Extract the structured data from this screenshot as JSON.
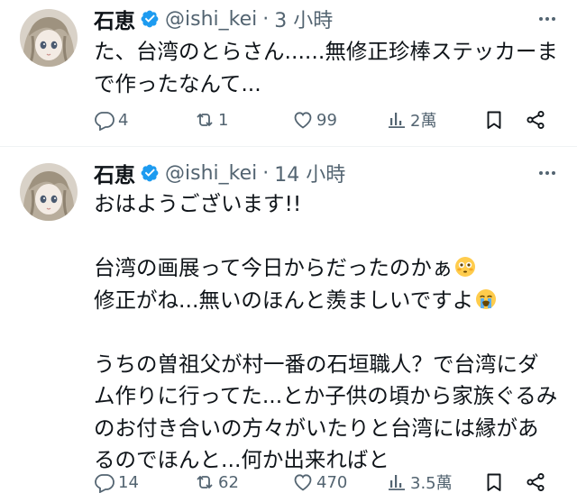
{
  "tweets": [
    {
      "name": "石恵",
      "handle": "@ishi_kei",
      "separator": "·",
      "time": "3 小時",
      "lines": [
        "た、台湾のとらさん......無修正珍棒ステッカーま",
        "で作ったなんて..."
      ],
      "reply_count": "4",
      "retweet_count": "1",
      "like_count": "99",
      "view_count": "2萬"
    },
    {
      "name": "石恵",
      "handle": "@ishi_kei",
      "separator": "·",
      "time": "14 小時",
      "line1": "おはようございます!!",
      "line2": "台湾の画展って今日からだったのかぁ",
      "line3": "修正がね...無いのほんと羨ましいですよ",
      "line4": "うちの曽祖父が村一番の石垣職人？で台湾にダ",
      "line5": "ム作りに行ってた...とか子供の頃から家族ぐるみ",
      "line6": "のお付き合いの方々がいたりと台湾には縁があ",
      "line7": "るのでほんと...何か出来ればと",
      "reply_count": "14",
      "retweet_count": "62",
      "like_count": "470",
      "view_count": "3.5萬"
    }
  ],
  "colors": {
    "verified": "#1d9bf0",
    "muted": "#536471",
    "text": "#0f1419",
    "divider": "#eff3f4"
  },
  "icons": [
    "verified-badge-icon",
    "more-icon",
    "reply-icon",
    "retweet-icon",
    "like-icon",
    "views-icon",
    "bookmark-icon",
    "share-icon",
    "flushed-face-emoji",
    "loudly-crying-face-emoji"
  ]
}
